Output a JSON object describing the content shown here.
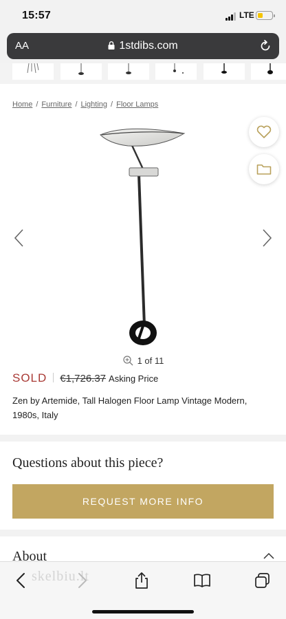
{
  "status": {
    "time": "15:57",
    "network": "LTE"
  },
  "browser": {
    "text_size_label": "AA",
    "url": "1stdibs.com"
  },
  "breadcrumb": [
    "Home",
    "Furniture",
    "Lighting",
    "Floor Lamps"
  ],
  "gallery": {
    "counter": "1 of 11"
  },
  "listing": {
    "status": "SOLD",
    "old_price": "€1,726.37",
    "price_label": "Asking Price",
    "title": "Zen by Artemide, Tall Halogen Floor Lamp Vintage Modern, 1980s, Italy"
  },
  "inquiry": {
    "heading": "Questions about this piece?",
    "button_label": "REQUEST MORE INFO"
  },
  "about": {
    "heading": "About"
  },
  "watermark": "skelbiu.lt",
  "colors": {
    "sold": "#a93a35",
    "accent_gold": "#c2a661",
    "address_bar": "#3a3a3c"
  },
  "icons": [
    "lock-icon",
    "reload-icon",
    "heart-icon",
    "folder-icon",
    "chevron-left-icon",
    "chevron-right-icon",
    "zoom-icon",
    "chevron-up-icon",
    "share-icon",
    "book-icon",
    "tabs-icon"
  ]
}
